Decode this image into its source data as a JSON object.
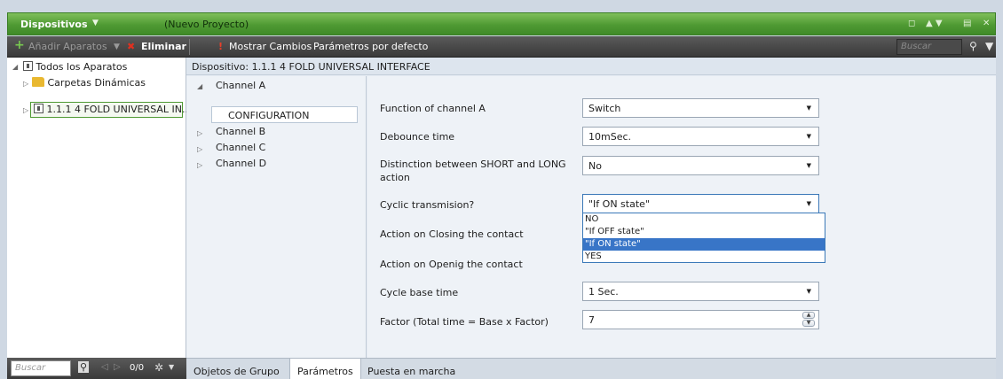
{
  "titlebar": {
    "title": "Dispositivos",
    "title_dropdown_icon": "▼",
    "project": "(Nuevo Proyecto)",
    "window_controls": [
      "◻",
      "▲ ▼",
      "▤",
      "✕"
    ]
  },
  "toolbar": {
    "add_icon": "+",
    "add_label": "Añadir Aparatos",
    "add_dropdown_icon": "▼",
    "delete_icon": "✖",
    "delete_label": "Eliminar",
    "show_changes_icon": "!",
    "show_changes_label": "Mostrar Cambios",
    "defaults_label": "Parámetros por defecto",
    "search_placeholder": "Buscar",
    "search_icon": "⚲",
    "filter_icon": "▼"
  },
  "tree": {
    "items": [
      {
        "label": "Todos los Aparatos",
        "expander": "◢"
      },
      {
        "label": "Carpetas Dinámicas",
        "expander": "▷"
      },
      {
        "label": "1.1.1  4 FOLD UNIVERSAL IN...",
        "expander": "▷"
      }
    ],
    "footer": {
      "search_placeholder": "Buscar",
      "search_icon": "⚲",
      "prev": "◁",
      "next": "▷",
      "count": "0/0",
      "gear_icon": "✲",
      "gear_dropdown": "▼"
    }
  },
  "device_header": "Dispositivo: 1.1.1  4 FOLD UNIVERSAL INTERFACE",
  "channels": {
    "items": [
      {
        "label": "Channel A",
        "expander": "◢"
      },
      {
        "label": "Channel B",
        "expander": "▷"
      },
      {
        "label": "Channel C",
        "expander": "▷"
      },
      {
        "label": "Channel D",
        "expander": "▷"
      }
    ],
    "configuration": "CONFIGURATION"
  },
  "params": [
    {
      "label": "Function of channel A",
      "value": "Switch"
    },
    {
      "label": "Debounce time",
      "value": "10mSec."
    },
    {
      "label": "Distinction between SHORT and LONG action",
      "value": "No"
    },
    {
      "label": "Cyclic transmision?",
      "value": "\"If ON state\""
    },
    {
      "label": "Action on Closing the contact"
    },
    {
      "label": "Action on Openig the contact"
    },
    {
      "label": "Cycle base time",
      "value": "1 Sec."
    },
    {
      "label": "Factor (Total time = Base x Factor)",
      "value": "7"
    }
  ],
  "dropdown_open": {
    "options": [
      "NO",
      "\"If OFF state\"",
      "\"If ON state\"",
      "YES"
    ],
    "highlighted": "\"If ON state\""
  },
  "dropdown_arrow": "▼",
  "spinner": {
    "up": "▲",
    "down": "▼"
  },
  "tabs": [
    "Objetos de Grupo",
    "Parámetros",
    "Puesta en marcha"
  ],
  "active_tab": "Parámetros",
  "colors": {
    "titlebar_green": "#4f9a33",
    "toolbar_dark": "#3a3a3a",
    "highlight_blue": "#3875c7"
  }
}
